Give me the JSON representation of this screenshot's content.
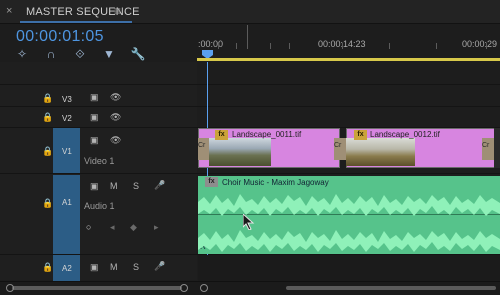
{
  "panel": {
    "close_glyph": "×",
    "title": "MASTER SEQUENCE",
    "menu_glyph": "≡"
  },
  "timecode": "00:00:01:05",
  "tools": [
    {
      "name": "snap-icon",
      "glyph": "✧"
    },
    {
      "name": "magnet-icon",
      "glyph": "∩"
    },
    {
      "name": "linked-selection-icon",
      "glyph": "⟐"
    },
    {
      "name": "add-marker-icon",
      "glyph": "▼"
    },
    {
      "name": "wrench-icon",
      "glyph": "🔧"
    }
  ],
  "ruler": {
    "labels": [
      ":00:00",
      "00:00:14:23",
      "00:00:29"
    ]
  },
  "tracks": [
    {
      "id": "V3",
      "name": "",
      "type": "video"
    },
    {
      "id": "V2",
      "name": "",
      "type": "video"
    },
    {
      "id": "V1",
      "name": "Video 1",
      "type": "video"
    },
    {
      "id": "A1",
      "name": "Audio 1",
      "type": "audio"
    },
    {
      "id": "A2",
      "name": "",
      "type": "audio"
    }
  ],
  "controls": {
    "mute": "M",
    "solo": "S",
    "mic_glyph": "🎤",
    "lock_glyph": "🔒",
    "eye_glyph": "👁"
  },
  "clips": {
    "video": [
      {
        "label": "Landscape_0011.tif",
        "fx": "fx",
        "cross": "Cr"
      },
      {
        "label": "Landscape_0012.tif",
        "fx": "fx",
        "cross": "Cr"
      }
    ],
    "audio": {
      "label": "Choir Music - Maxim Jagoway",
      "fx": "fx",
      "marker_l": "L",
      "marker_r": "R"
    }
  },
  "colors": {
    "accent": "#4e95e0",
    "target": "#2c5d86",
    "pink_clip": "#d785e0",
    "audio_clip": "#56c38b",
    "yellow_bar": "#d7c84a"
  }
}
